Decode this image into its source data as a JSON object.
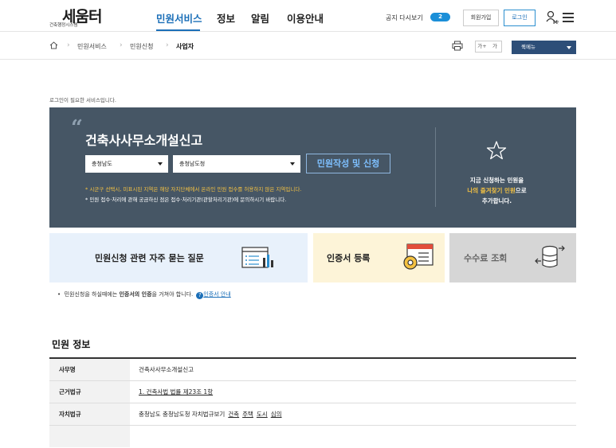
{
  "header": {
    "logo_text": "세움터",
    "logo_sub": "건축행정시스템",
    "nav": [
      "민원서비스",
      "정보",
      "알림",
      "이용안내"
    ],
    "notice_label": "공지 다시보기",
    "notice_count": "2",
    "join_label": "회원가입",
    "login_label": "로그인",
    "my_label": "My"
  },
  "breadcrumb": {
    "items": [
      "민원서비스",
      "민원신청",
      "사업자"
    ],
    "font_small": "가+",
    "font_large": "가",
    "quick_menu": "퀵메뉴"
  },
  "login_note": "로그인이 필요한 서비스입니다.",
  "panel": {
    "title": "건축사사무소개설신고",
    "select_sido": "충청남도",
    "select_sigungu": "충청남도청",
    "apply_label": "민원작성 및 신청",
    "warning": "* 시군구 선택시, 미표시된 지역은 해당 자치단체에서 온라인 민원 접수를 허용하지 않은 지역입니다.",
    "info": "* 민원 접수·처리에 관해 궁금하신 점은 접수·처리기관(관할처리기관)에 문의하시기 바랍니다.",
    "fav_line1": "지금 신청하는 민원을",
    "fav_line2_highlight": "나의 즐겨찾기 민원",
    "fav_line2_rest": "으로",
    "fav_line3": "추가합니다."
  },
  "cards": {
    "faq_label": "민원신청 관련 자주 묻는 질문",
    "cert_label": "인증서 등록",
    "fee_label": "수수료 조회"
  },
  "hint": {
    "prefix": "민원신청을 하실때에는 ",
    "bold": "인증서의 인증",
    "suffix": "을 거쳐야 합니다.",
    "link": "인증서 안내"
  },
  "info_section": {
    "title": "민원 정보",
    "rows": [
      {
        "label": "사무명",
        "value": "건축사사무소개설신고"
      },
      {
        "label": "근거법규",
        "value": "1. 건축사법 법률 제23조 1항"
      },
      {
        "label": "자치법규",
        "value": "충청남도 충청남도청 자치법규보기",
        "links": [
          "건축",
          "주택",
          "도시",
          "심의"
        ]
      }
    ]
  },
  "colors": {
    "accent": "#1b6fb8",
    "panel_bg": "#465665",
    "warning": "#f5c242"
  }
}
